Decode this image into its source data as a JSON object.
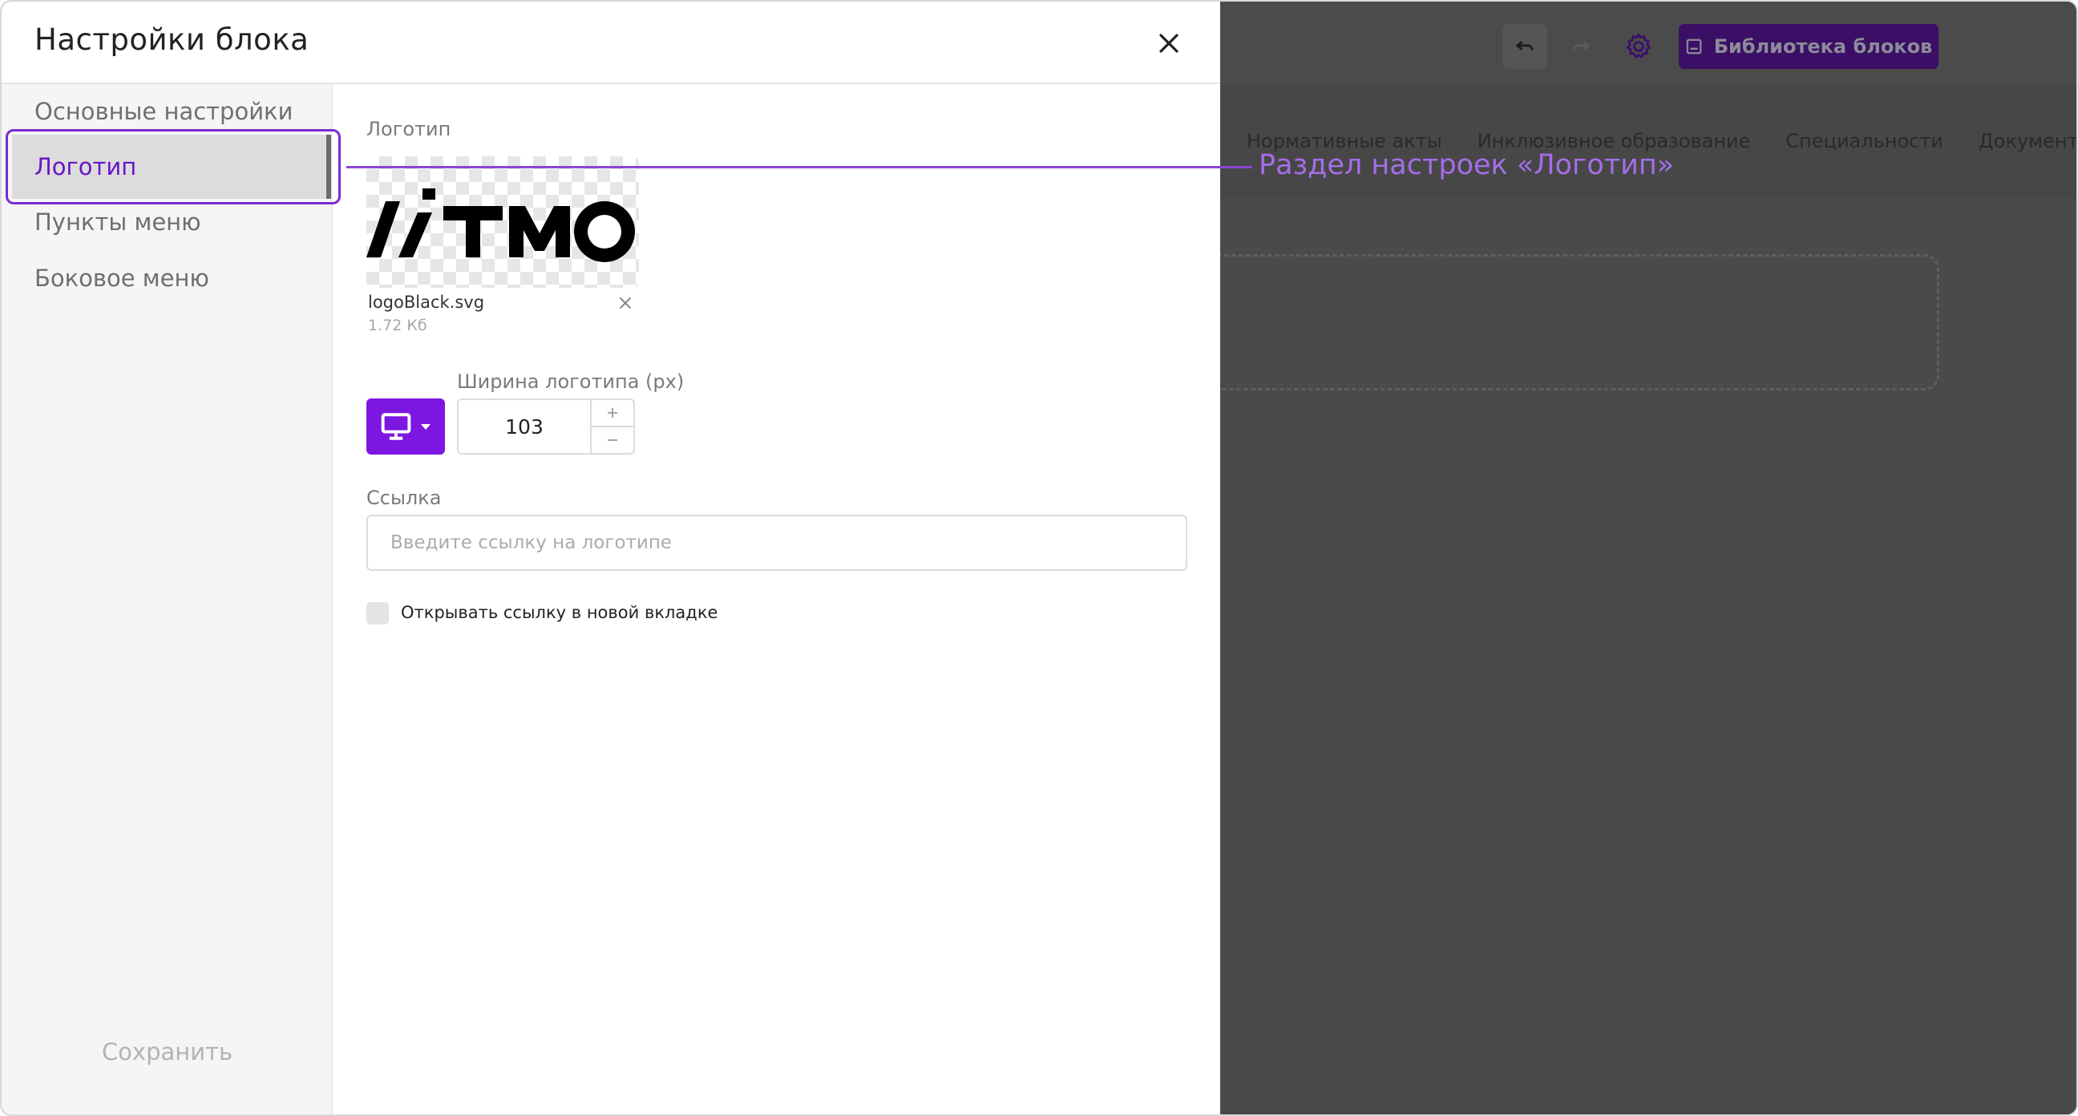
{
  "modal": {
    "title": "Настройки блока",
    "sidebar": {
      "items": [
        {
          "label": "Основные настройки"
        },
        {
          "label": "Логотип",
          "active": true
        },
        {
          "label": "Пункты меню"
        },
        {
          "label": "Боковое меню"
        }
      ],
      "save_label": "Сохранить"
    },
    "logo_section": {
      "label": "Логотип",
      "logo_text": "ИТМО",
      "file_name": "logoBlack.svg",
      "file_size": "1.72 Кб"
    },
    "width": {
      "label": "Ширина логотипа (px)",
      "value": "103",
      "device": "desktop-icon"
    },
    "link": {
      "label": "Ссылка",
      "value": "",
      "placeholder": "Введите ссылку на логотипе"
    },
    "new_tab": {
      "label": "Открывать ссылку в новой вкладке",
      "checked": false
    }
  },
  "editor_background": {
    "library_button": "Библиотека блоков",
    "nav_items": [
      "Нормативные акты",
      "Инклюзивное образование",
      "Специальности",
      "Документы"
    ]
  },
  "annotation": {
    "text": "Раздел настроек «Логотип»"
  },
  "colors": {
    "accent": "#7d16e0",
    "annotation": "#a46ee8",
    "library_button_bg": "#3b0f66"
  }
}
